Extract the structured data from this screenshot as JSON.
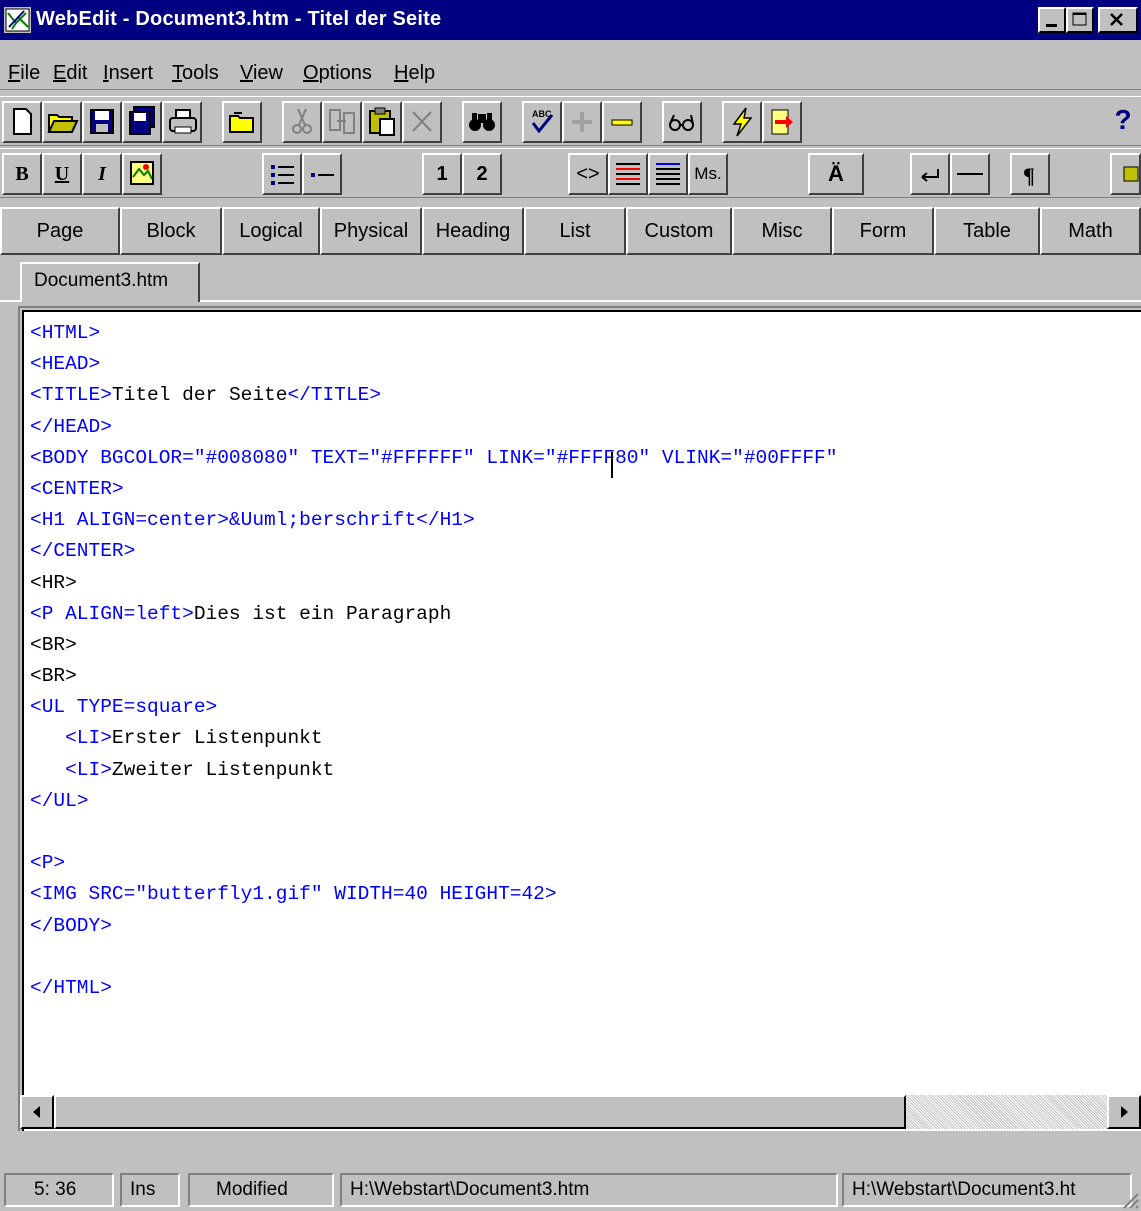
{
  "window": {
    "title": "WebEdit - Document3.htm - Titel der Seite",
    "title_bg": "#000080"
  },
  "menu": [
    {
      "label": "File",
      "key": "F",
      "rest": "ile"
    },
    {
      "label": "Edit",
      "key": "E",
      "rest": "dit"
    },
    {
      "label": "Insert",
      "key": "I",
      "rest": "nsert"
    },
    {
      "label": "Tools",
      "key": "T",
      "rest": "ools"
    },
    {
      "label": "View",
      "key": "V",
      "rest": "iew"
    },
    {
      "label": "Options",
      "key": "O",
      "rest": "ptions"
    },
    {
      "label": "Help",
      "key": "H",
      "rest": "elp"
    }
  ],
  "toolbar2": {
    "bold": "B",
    "underline": "U",
    "italic": "I",
    "num1": "1",
    "num2": "2",
    "tags": "<>",
    "ms": "Ms.",
    "umlaut": "Ä",
    "help": "?"
  },
  "tag_tabs": [
    "Page",
    "Block",
    "Logical",
    "Physical",
    "Heading",
    "List",
    "Custom",
    "Misc",
    "Form",
    "Table",
    "Math"
  ],
  "document_tab": "Document3.htm",
  "code_lines": [
    [
      {
        "t": "tag",
        "v": "<HTML>"
      }
    ],
    [
      {
        "t": "tag",
        "v": "<HEAD>"
      }
    ],
    [
      {
        "t": "tag",
        "v": "<TITLE>"
      },
      {
        "t": "txt",
        "v": "Titel der Seite"
      },
      {
        "t": "tag",
        "v": "</TITLE>"
      }
    ],
    [
      {
        "t": "tag",
        "v": "</HEAD>"
      }
    ],
    [
      {
        "t": "tag",
        "v": "<BODY BGCOLOR=\"#008080\" TEXT=\"#FFFFFF\" LINK=\"#FFFF80\" VLINK=\"#00FFFF\""
      }
    ],
    [
      {
        "t": "tag",
        "v": "<CENTER>"
      }
    ],
    [
      {
        "t": "tag",
        "v": "<H1 ALIGN=center>&Uuml;berschrift</H1>"
      }
    ],
    [
      {
        "t": "tag",
        "v": "</CENTER>"
      }
    ],
    [
      {
        "t": "txt",
        "v": "<HR>"
      }
    ],
    [
      {
        "t": "tag",
        "v": "<P ALIGN=left>"
      },
      {
        "t": "txt",
        "v": "Dies ist ein Paragraph"
      }
    ],
    [
      {
        "t": "txt",
        "v": "<BR>"
      }
    ],
    [
      {
        "t": "txt",
        "v": "<BR>"
      }
    ],
    [
      {
        "t": "tag",
        "v": "<UL TYPE=square>"
      }
    ],
    [
      {
        "t": "txt",
        "v": "   "
      },
      {
        "t": "tag",
        "v": "<LI>"
      },
      {
        "t": "txt",
        "v": "Erster Listenpunkt"
      }
    ],
    [
      {
        "t": "txt",
        "v": "   "
      },
      {
        "t": "tag",
        "v": "<LI>"
      },
      {
        "t": "txt",
        "v": "Zweiter Listenpunkt"
      }
    ],
    [
      {
        "t": "tag",
        "v": "</UL>"
      }
    ],
    [
      {
        "t": "txt",
        "v": ""
      }
    ],
    [
      {
        "t": "tag",
        "v": "<P>"
      }
    ],
    [
      {
        "t": "tag",
        "v": "<IMG SRC=\"butterfly1.gif\" WIDTH=40 HEIGHT=42>"
      }
    ],
    [
      {
        "t": "tag",
        "v": "</BODY>"
      }
    ],
    [
      {
        "t": "txt",
        "v": ""
      }
    ],
    [
      {
        "t": "tag",
        "v": "</HTML>"
      }
    ]
  ],
  "status": {
    "position": "5: 36",
    "mode": "Ins",
    "state": "Modified",
    "path": "H:\\Webstart\\Document3.htm",
    "path_right": "H:\\Webstart\\Document3.ht"
  },
  "colors": {
    "tag": "#0000ff",
    "text": "#000000",
    "chrome": "#c0c0c0"
  }
}
